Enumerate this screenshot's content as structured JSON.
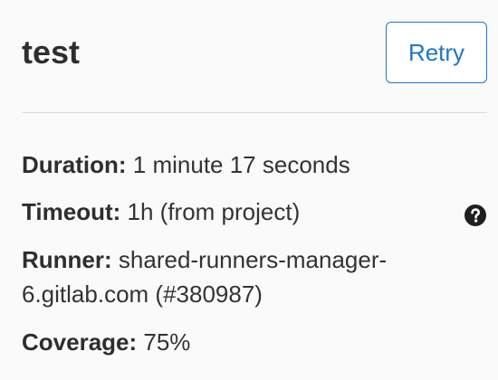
{
  "job": {
    "title": "test",
    "retry_label": "Retry"
  },
  "details": {
    "duration": {
      "label": "Duration:",
      "value": "1 minute 17 seconds"
    },
    "timeout": {
      "label": "Timeout:",
      "value": "1h (from project)",
      "help_icon": "question-circle-icon"
    },
    "runner": {
      "label": "Runner:",
      "value": "shared-runners-manager-",
      "value_line2": "6.gitlab.com (#380987)"
    },
    "coverage": {
      "label": "Coverage:",
      "value": "75%"
    }
  },
  "colors": {
    "accent": "#1f75cb",
    "text": "#2e2e2e",
    "divider": "#dcdcdc",
    "background": "#fafafa"
  }
}
